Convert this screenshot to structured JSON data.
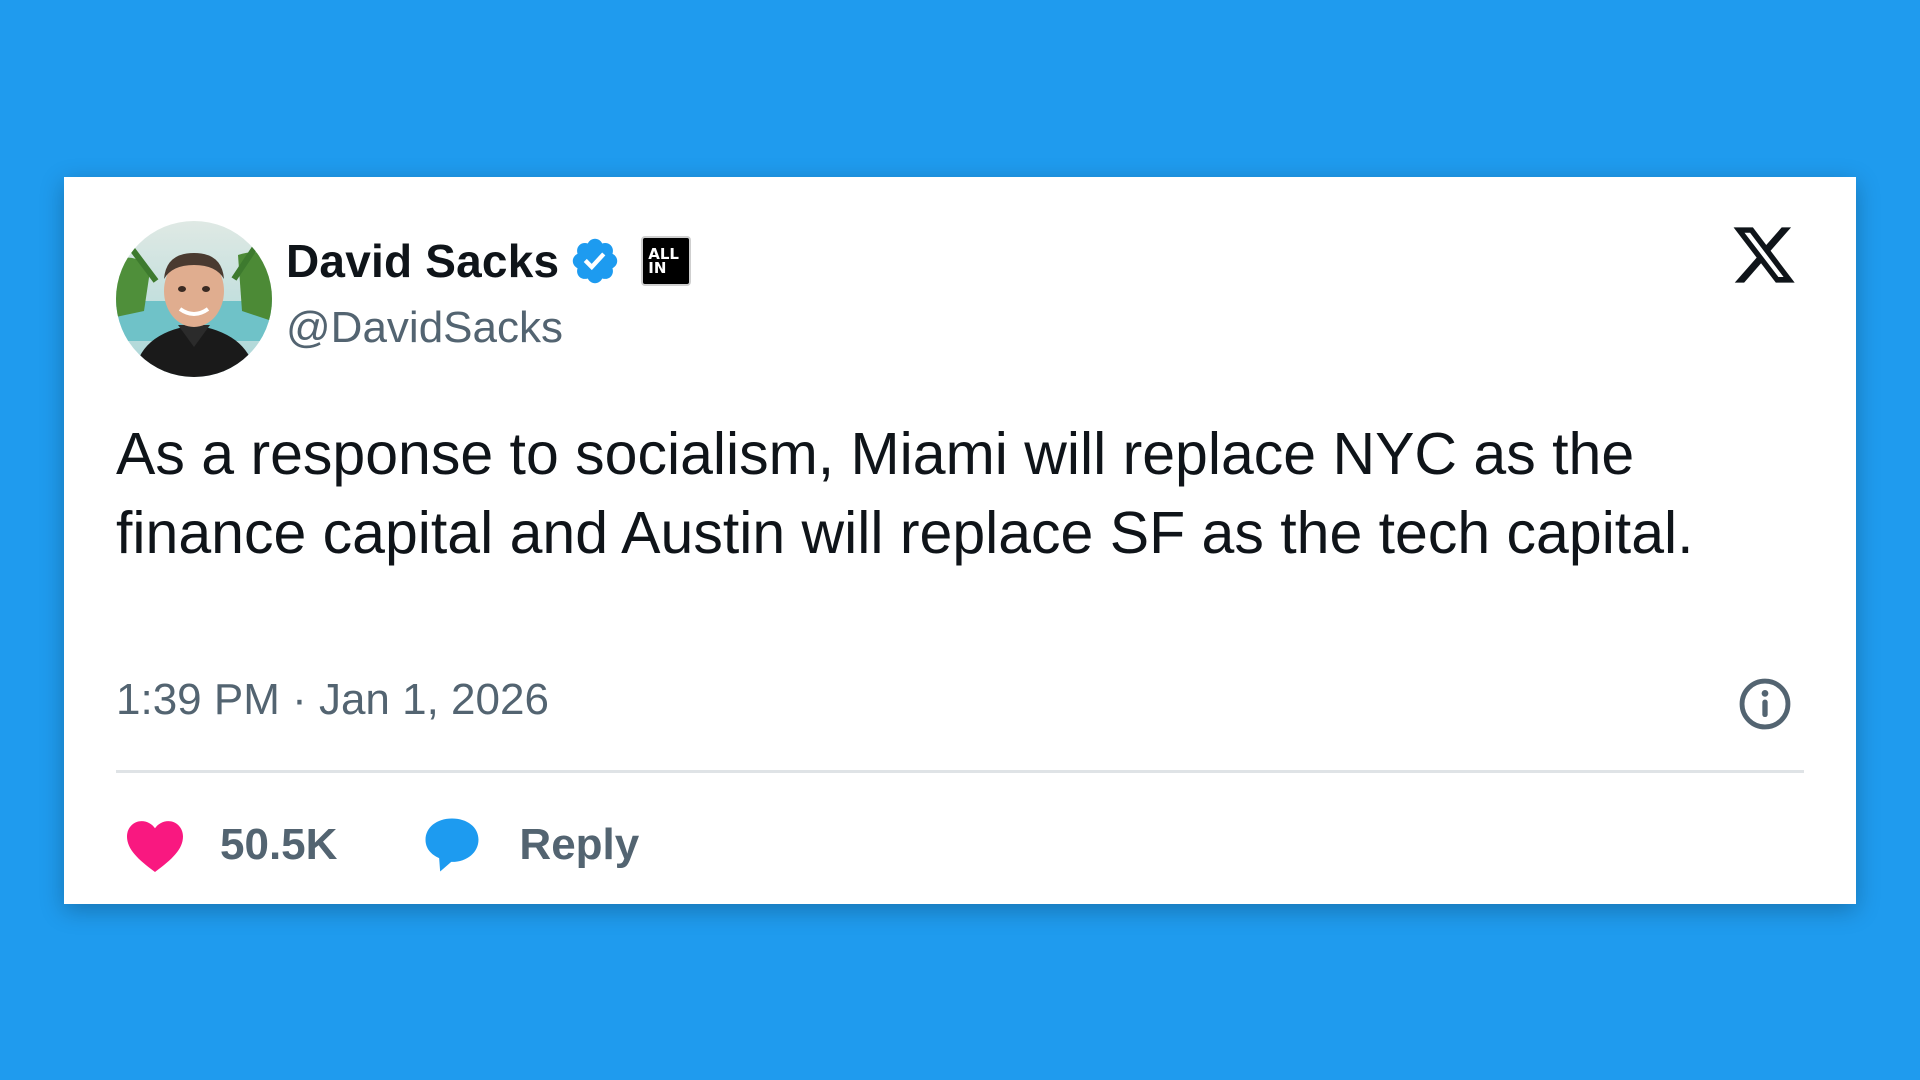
{
  "colors": {
    "background": "#1f9bee",
    "card": "#ffffff",
    "text_primary": "#0f1419",
    "text_secondary": "#536471",
    "verified_blue": "#1d9bf0",
    "like_pink": "#f91880",
    "reply_blue": "#1d9bf0"
  },
  "author": {
    "display_name": "David Sacks",
    "handle": "@DavidSacks",
    "verified_icon": "verified-badge-icon",
    "affiliation_badge": {
      "line1": "ALL",
      "line2": "IN"
    }
  },
  "platform_icon": "x-logo-icon",
  "tweet": {
    "text": "As a response to socialism, Miami will replace NYC as the finance capital and Austin will replace SF as the tech capital.",
    "timestamp": "1:39 PM · Jan 1, 2026"
  },
  "actions": {
    "like_icon": "heart-icon",
    "like_count": "50.5K",
    "reply_icon": "speech-bubble-icon",
    "reply_label": "Reply",
    "info_icon": "info-icon"
  }
}
